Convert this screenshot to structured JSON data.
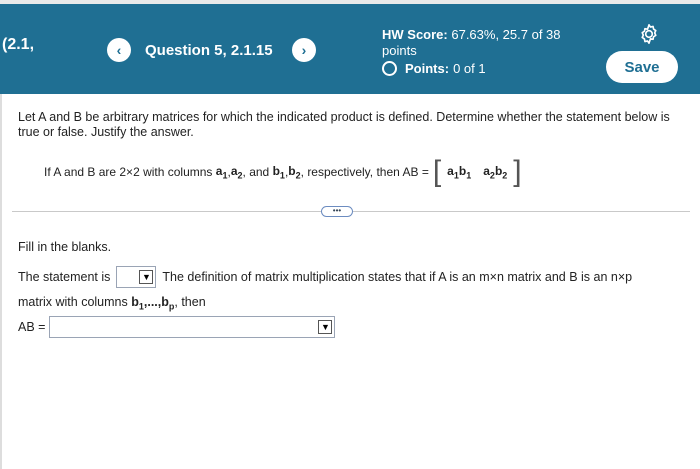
{
  "header": {
    "section": "(2.1,",
    "question": "Question 5, 2.1.15",
    "prev_icon": "chevron-left",
    "next_icon": "chevron-right",
    "hw_score_label": "HW Score:",
    "hw_score_value": "67.63%, 25.7 of 38",
    "hw_score_unit": "points",
    "points_label": "Points:",
    "points_value": "0 of 1",
    "settings_icon": "gear-icon",
    "save_label": "Save",
    "colors": {
      "header_bg": "#1f6f93",
      "text": "#ffffff"
    }
  },
  "problem": {
    "prompt": "Let A and B be arbitrary matrices for which the indicated product is defined. Determine whether the statement below is true or false. Justify the answer.",
    "statement_prefix": "If A and B are 2×2 with columns",
    "statement_mid": "and",
    "statement_suffix": "respectively, then AB =",
    "more_label": "•••"
  },
  "answer": {
    "fill_blanks": "Fill in the blanks.",
    "statement_is": "The statement is",
    "definition_text": "The definition of matrix multiplication states that if A is an m×n matrix and B is an n×p",
    "matrix_with_columns": "matrix with columns",
    "then": ", then",
    "ab_label": "AB ="
  }
}
